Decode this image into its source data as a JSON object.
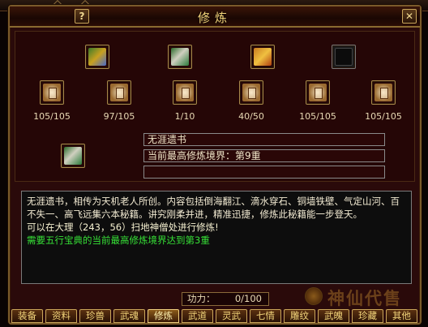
{
  "window": {
    "title": "修炼",
    "help_label": "?",
    "close_label": "✕"
  },
  "top_books": [
    {
      "icon": "five-colored-book-icon"
    },
    {
      "icon": "green-scroll-bundle-icon"
    },
    {
      "icon": "golden-book-icon"
    },
    {
      "icon": "empty-slot-icon"
    }
  ],
  "scrolls": [
    {
      "icon": "orange-scroll-icon",
      "count": "105/105"
    },
    {
      "icon": "pink-scroll-icon",
      "count": "97/105"
    },
    {
      "icon": "white-scroll-icon",
      "count": "1/10"
    },
    {
      "icon": "red-scroll-icon",
      "count": "40/50"
    },
    {
      "icon": "purple-scroll-icon",
      "count": "105/105"
    },
    {
      "icon": "teal-scroll-icon",
      "count": "105/105"
    }
  ],
  "selected": {
    "icon": "scroll-bundle-icon",
    "name": "无涯遗书",
    "realm": "当前最高修炼境界：第9重",
    "extra": ""
  },
  "description": {
    "main": "无涯遗书，相传为天机老人所创。内容包括倒海翻江、滴水穿石、铜墙铁壁、气定山河、百不失一、高飞远集六本秘籍。讲究刚柔并进，精准迅捷，修炼此秘籍能一步登天。",
    "location": "可以在大理（243，56）扫地神僧处进行修炼!",
    "requirement": "需要五行宝典的当前最高修炼境界达到第3重"
  },
  "gongli": {
    "label": "功力：",
    "value": "0/100"
  },
  "watermark": {
    "text": "神仙代售"
  },
  "tabs": [
    "装备",
    "资料",
    "珍兽",
    "武魂",
    "修炼",
    "武道",
    "灵武",
    "七情",
    "雕纹",
    "武魄",
    "珍藏",
    "其他"
  ],
  "active_tab": "修炼"
}
